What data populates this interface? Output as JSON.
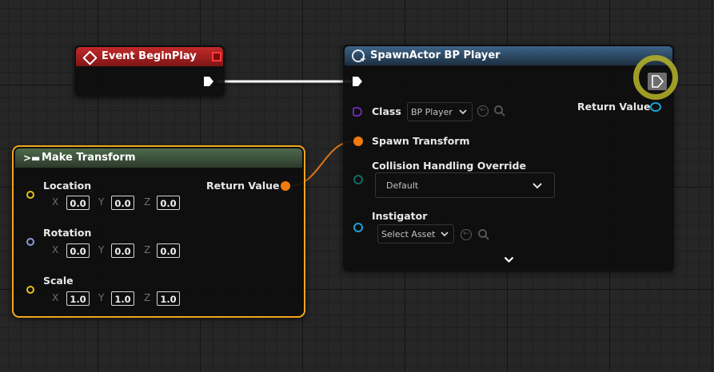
{
  "event_node": {
    "title": "Event BeginPlay"
  },
  "make_transform": {
    "title": "Make Transform",
    "return_label": "Return Value",
    "location": {
      "label": "Location",
      "x": "0.0",
      "y": "0.0",
      "z": "0.0"
    },
    "rotation": {
      "label": "Rotation",
      "x": "0.0",
      "y": "0.0",
      "z": "0.0"
    },
    "scale": {
      "label": "Scale",
      "x": "1.0",
      "y": "1.0",
      "z": "1.0"
    },
    "axis_x": "X",
    "axis_y": "Y",
    "axis_z": "Z"
  },
  "spawn_actor": {
    "title": "SpawnActor BP Player",
    "class_label": "Class",
    "class_value": "BP Player",
    "return_label": "Return Value",
    "spawn_transform_label": "Spawn Transform",
    "collision_label": "Collision Handling Override",
    "collision_value": "Default",
    "instigator_label": "Instigator",
    "instigator_value": "Select Asset"
  },
  "colors": {
    "event_header": "#a11d1d",
    "function_header": "#2f4d69",
    "make_header": "#3f5a3f",
    "exec_pin": "#ffffff",
    "transform_pin": "#f07a0e",
    "vector_pin": "#e5c21c",
    "rotator_pin": "#8c9ad9",
    "class_pin": "#6a2bb0",
    "enum_pin": "#0e6b62",
    "object_pin": "#1aa0d8",
    "selection_outline": "#f3a51c",
    "cursor_highlight": "#b8b52a"
  }
}
